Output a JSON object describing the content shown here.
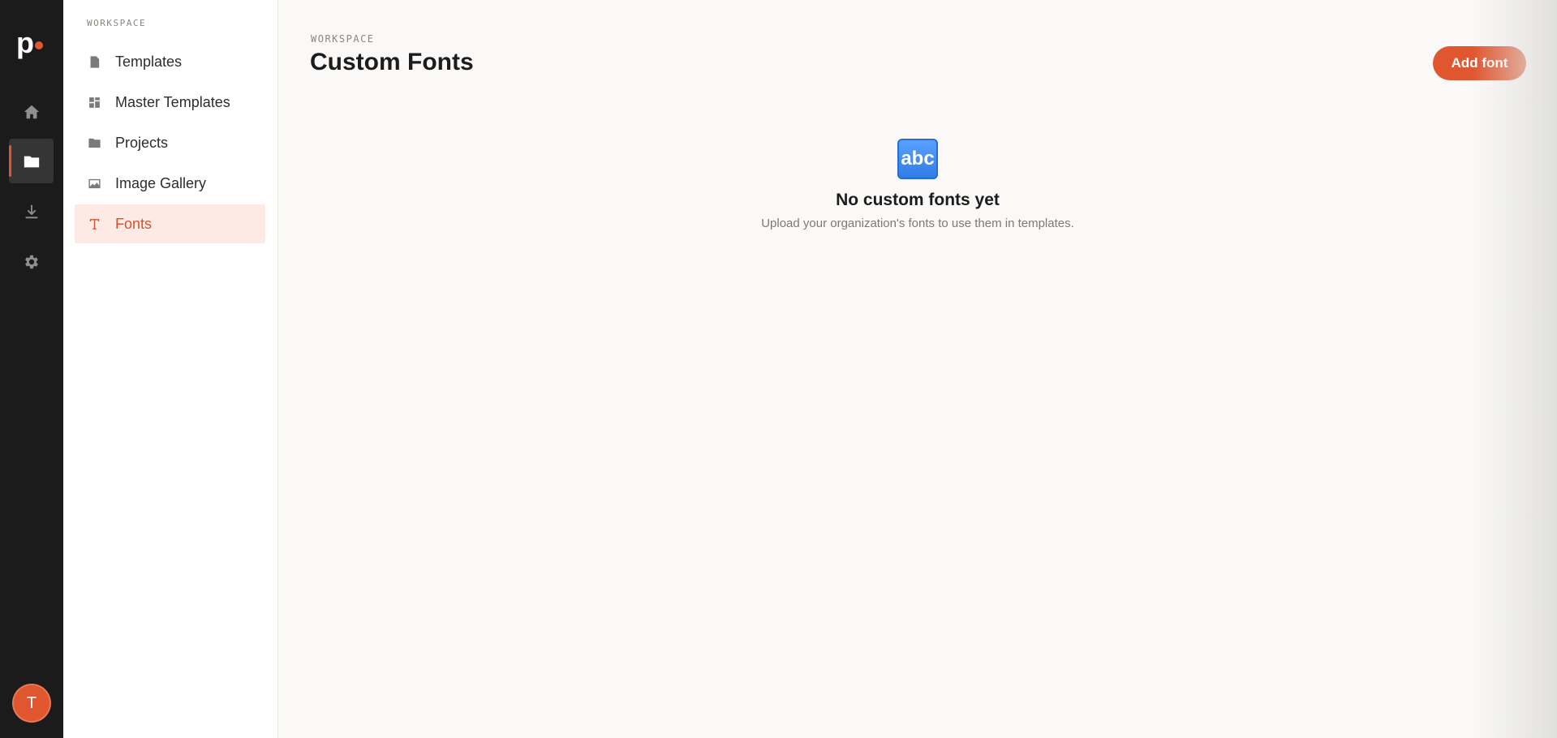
{
  "rail": {
    "logo": "p",
    "items": [
      {
        "name": "home-icon",
        "active": false
      },
      {
        "name": "folder-icon",
        "active": true
      },
      {
        "name": "download-icon",
        "active": false
      },
      {
        "name": "gear-icon",
        "active": false
      }
    ],
    "avatar_initial": "T"
  },
  "sidebar": {
    "heading": "WORKSPACE",
    "items": [
      {
        "label": "Templates",
        "icon": "document-icon",
        "active": false
      },
      {
        "label": "Master Templates",
        "icon": "grid-icon",
        "active": false
      },
      {
        "label": "Projects",
        "icon": "folder-icon",
        "active": false
      },
      {
        "label": "Image Gallery",
        "icon": "image-icon",
        "active": false
      },
      {
        "label": "Fonts",
        "icon": "font-icon",
        "active": true
      }
    ]
  },
  "main": {
    "eyebrow": "WORKSPACE",
    "title": "Custom Fonts",
    "add_button": "Add font",
    "empty_state": {
      "icon_text": "abc",
      "title": "No custom fonts yet",
      "subtitle": "Upload your organization's fonts to use them in templates."
    }
  },
  "colors": {
    "accent": "#e0562f",
    "rail_bg": "#1b1b1b",
    "active_nav_bg": "#fdeae4"
  }
}
